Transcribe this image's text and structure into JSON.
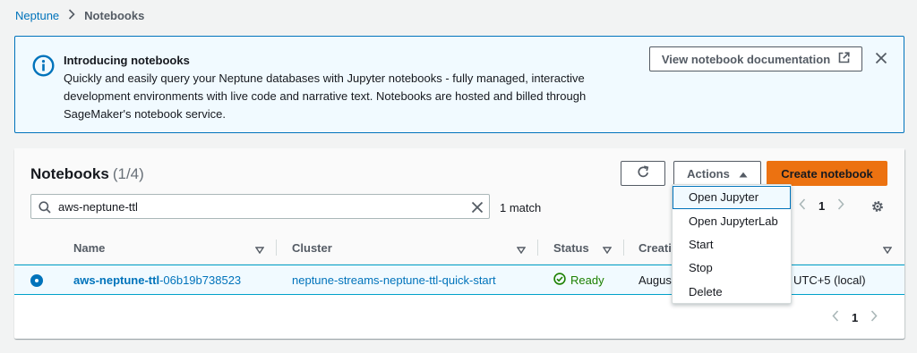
{
  "breadcrumb": {
    "parent": "Neptune",
    "current": "Notebooks"
  },
  "banner": {
    "title": "Introducing notebooks",
    "text": "Quickly and easily query your Neptune databases with Jupyter notebooks - fully managed, interactive development environments with live code and narrative text. Notebooks are hosted and billed through SageMaker's notebook service.",
    "doc_button": "View notebook documentation",
    "icon": "info-icon"
  },
  "panel": {
    "title": "Notebooks",
    "count": "(1/4)",
    "actions_label": "Actions",
    "create_label": "Create notebook",
    "search": {
      "value": "aws-neptune-ttl"
    },
    "match_count": "1 match",
    "page": "1"
  },
  "table": {
    "columns": [
      "Name",
      "Cluster",
      "Status",
      "Creatio",
      ""
    ],
    "rows": [
      {
        "name_bold": "aws-neptune-ttl",
        "name_rest": "-06b19b738523",
        "cluster": "neptune-streams-neptune-ttl-quick-start",
        "status": "Ready",
        "creation_left": "August",
        "creation_right": "UTC+5 (local)"
      }
    ]
  },
  "actions_menu": [
    "Open Jupyter",
    "Open JupyterLab",
    "Start",
    "Stop",
    "Delete"
  ],
  "colors": {
    "accent": "#0073bb",
    "primary_button": "#ec7211",
    "status_ok": "#1d8102",
    "banner_bg": "#f1faff"
  }
}
